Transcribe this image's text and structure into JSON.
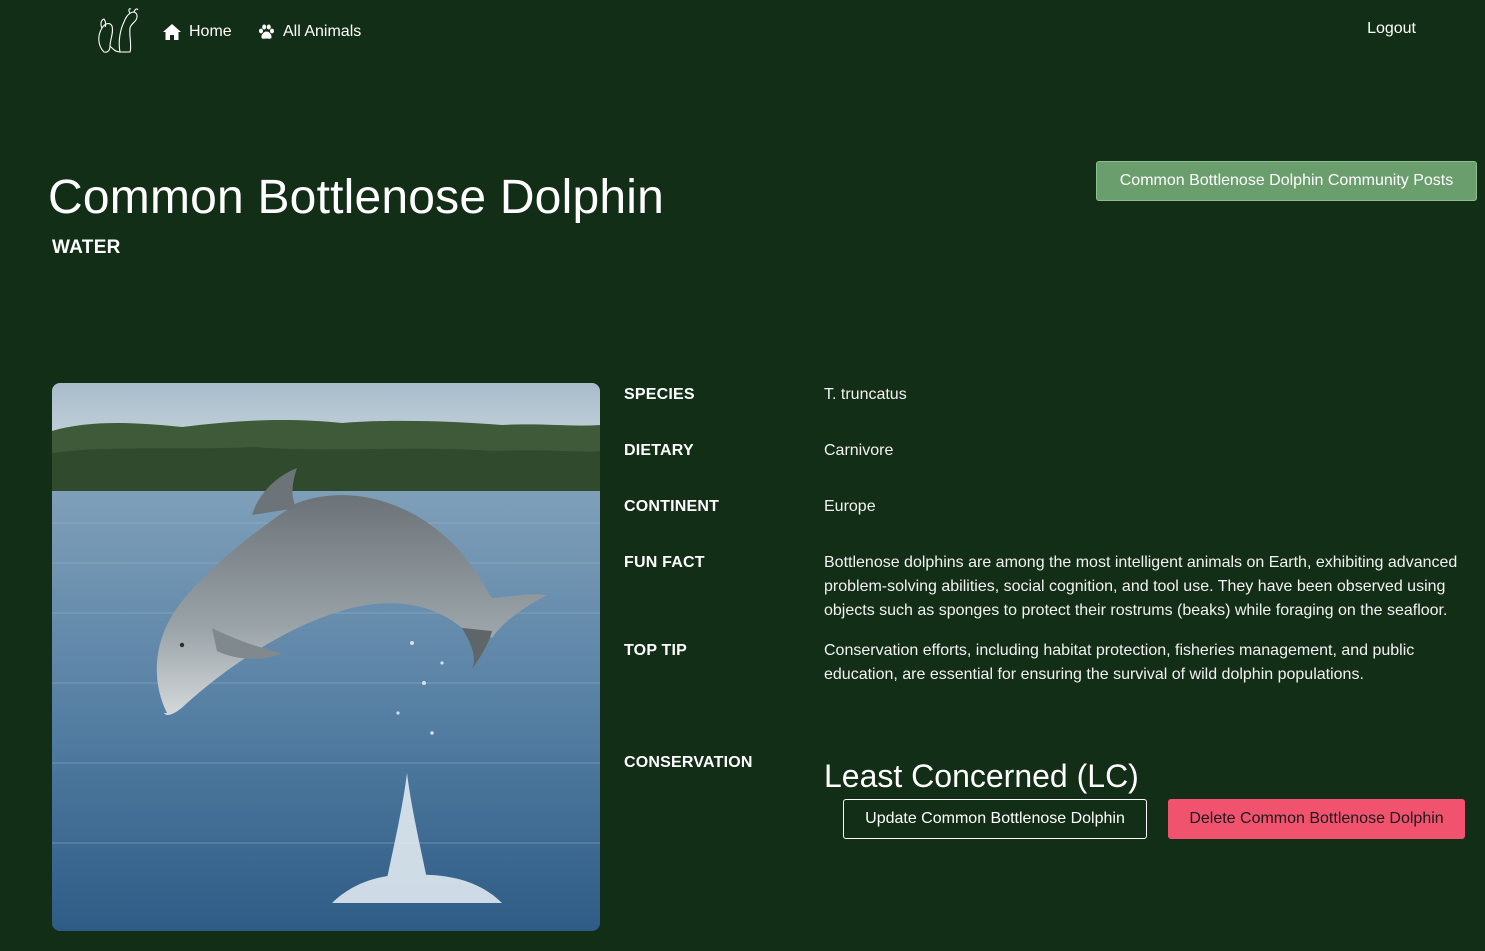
{
  "nav": {
    "home_label": "Home",
    "all_animals_label": "All Animals",
    "logout_label": "Logout",
    "logo_icon": "dog-cat-outline-logo",
    "home_icon": "home-icon",
    "paw_icon": "paw-icon"
  },
  "animal": {
    "name": "Common Bottlenose Dolphin",
    "habitat": "WATER",
    "image_icon": "dolphin-photo"
  },
  "actions": {
    "community_posts_label": "Common Bottlenose Dolphin Community Posts",
    "update_label": "Update Common Bottlenose Dolphin",
    "delete_label": "Delete Common Bottlenose Dolphin"
  },
  "details": {
    "species": {
      "label": "SPECIES",
      "value": "T. truncatus"
    },
    "dietary": {
      "label": "DIETARY",
      "value": "Carnivore"
    },
    "continent": {
      "label": "CONTINENT",
      "value": "Europe"
    },
    "fun_fact": {
      "label": "FUN FACT",
      "value": "Bottlenose dolphins are among the most intelligent animals on Earth, exhibiting advanced problem-solving abilities, social cognition, and tool use. They have been observed using objects such as sponges to protect their rostrums (beaks) while foraging on the seafloor."
    },
    "top_tip": {
      "label": "TOP TIP",
      "value": "Conservation efforts, including habitat protection, fisheries management, and public education, are essential for ensuring the survival of wild dolphin populations."
    },
    "conservation": {
      "label": "CONSERVATION",
      "value": "Least Concerned (LC)"
    }
  },
  "colors": {
    "background": "#132e16",
    "community_button": "#6b9e6d",
    "delete_button": "#f1536f"
  }
}
